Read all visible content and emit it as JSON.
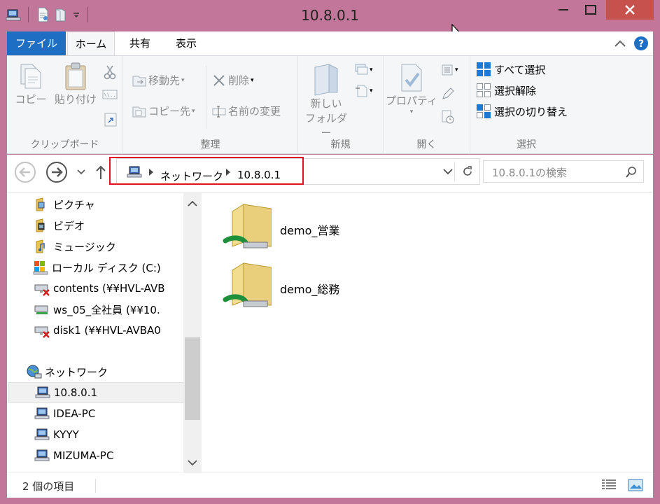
{
  "window": {
    "title": "10.8.0.1"
  },
  "ribbon_tabs": {
    "file": "ファイル",
    "home": "ホーム",
    "share": "共有",
    "view": "表示"
  },
  "ribbon": {
    "clipboard": {
      "copy": "コピー",
      "paste": "貼り付け",
      "label": "クリップボード"
    },
    "organize": {
      "move_to": "移動先",
      "copy_to": "コピー先",
      "delete": "削除",
      "rename": "名前の変更",
      "label": "整理"
    },
    "new": {
      "new_folder_line1": "新しい",
      "new_folder_line2": "フォルダー",
      "label": "新規"
    },
    "open": {
      "properties": "プロパティ",
      "label": "開く"
    },
    "select": {
      "select_all": "すべて選択",
      "select_none": "選択解除",
      "invert": "選択の切り替え",
      "label": "選択"
    }
  },
  "address": {
    "crumbs": [
      "ネットワーク",
      "10.8.0.1"
    ],
    "search_placeholder": "10.8.0.1の検索"
  },
  "tree": {
    "items": [
      {
        "label": "ピクチャ",
        "icon": "pictures-folder-icon"
      },
      {
        "label": "ビデオ",
        "icon": "videos-folder-icon"
      },
      {
        "label": "ミュージック",
        "icon": "music-folder-icon"
      },
      {
        "label": "ローカル ディスク (C:)",
        "icon": "local-disk-icon"
      },
      {
        "label": "contents (¥¥HVL-AVB",
        "icon": "disconnected-drive-icon"
      },
      {
        "label": "ws_05_全社員 (¥¥10.",
        "icon": "network-drive-icon"
      },
      {
        "label": "disk1 (¥¥HVL-AVBA0",
        "icon": "disconnected-drive-icon"
      }
    ],
    "network": {
      "label": "ネットワーク",
      "icon": "network-icon"
    },
    "hosts": [
      {
        "label": "10.8.0.1",
        "selected": true
      },
      {
        "label": "IDEA-PC",
        "selected": false
      },
      {
        "label": "KYYY",
        "selected": false
      },
      {
        "label": "MIZUMA-PC",
        "selected": false
      }
    ]
  },
  "files": [
    {
      "name": "demo_営業"
    },
    {
      "name": "demo_総務"
    }
  ],
  "status": {
    "item_count": "2 個の項目"
  },
  "colors": {
    "frame": "#c2779a",
    "file_tab": "#1e6fc3",
    "close_button": "#c7514b",
    "highlight_box": "#e0151c",
    "select_blue": "#1f78d1"
  }
}
